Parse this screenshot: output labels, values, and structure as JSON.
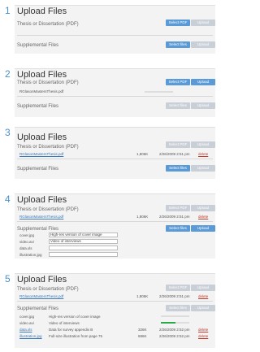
{
  "steps": [
    {
      "number": "1",
      "title": "Upload Files",
      "thesis_label": "Thesis or Dissertation (PDF)",
      "supp_label": "Supplemental Files",
      "select_pdf": "Select PDF",
      "upload": "Upload",
      "select_files": "Select files"
    },
    {
      "number": "2",
      "title": "Upload Files",
      "thesis_label": "Thesis or Dissertation (PDF)",
      "supp_label": "Supplemental Files",
      "select_pdf": "Select PDF",
      "upload": "Upload",
      "select_files": "Select files",
      "thesis_file": "RGlasonMastersThesis.pdf"
    },
    {
      "number": "3",
      "title": "Upload Files",
      "thesis_label": "Thesis or Dissertation (PDF)",
      "supp_label": "Supplemental Files",
      "select_pdf": "Select PDF",
      "upload": "Upload",
      "select_files": "Select files",
      "thesis_file": "RGlasonMastersThesis.pdf",
      "thesis_size": "1,806K",
      "thesis_date": "2/26/2009 2:51 pm",
      "thesis_delete": "delete"
    },
    {
      "number": "4",
      "title": "Upload Files",
      "thesis_label": "Thesis or Dissertation (PDF)",
      "supp_label": "Supplemental Files",
      "select_pdf": "Select PDF",
      "upload": "Upload",
      "select_files": "Select files",
      "thesis_file": "RGlasonMastersThesis.pdf",
      "thesis_size": "1,806K",
      "thesis_date": "2/26/2009 2:51 pm",
      "thesis_delete": "delete",
      "supp_files": [
        {
          "name": "cover.jpg",
          "desc": "High-res version of cover image"
        },
        {
          "name": "video.avi",
          "desc": "Video of interviews"
        },
        {
          "name": "data.xls",
          "desc": ""
        },
        {
          "name": "illustration.jpg",
          "desc": ""
        }
      ]
    },
    {
      "number": "5",
      "title": "Upload Files",
      "thesis_label": "Thesis or Dissertation (PDF)",
      "supp_label": "Supplemental Files",
      "select_pdf": "Select PDF",
      "upload": "Upload",
      "select_files": "Select files",
      "thesis_file": "RGlasonMastersThesis.pdf",
      "thesis_size": "1,806K",
      "thesis_date": "2/26/2009 2:51 pm",
      "thesis_delete": "delete",
      "supp_files": [
        {
          "name": "cover.jpg",
          "desc": "High-res version of cover image",
          "size": "",
          "date": "",
          "delete": ""
        },
        {
          "name": "video.avi",
          "desc": "Video of interviews",
          "size": "",
          "date": "",
          "delete": "",
          "progress": 0.5
        },
        {
          "name": "data.xls",
          "desc": "Data for survey appendix B",
          "size": "326K",
          "date": "2/26/2009 2:52 pm",
          "delete": "delete"
        },
        {
          "name": "illustration.jpg",
          "desc": "Full-size illustration from page 75",
          "size": "686K",
          "date": "2/26/2009 2:52 pm",
          "delete": "delete"
        }
      ]
    }
  ],
  "colors": {
    "accent": "#4a90c8",
    "button_blue": "#5a9ad6",
    "button_disabled": "#c9cfd6",
    "link": "#3a78b8",
    "delete": "#c0392b",
    "progress": "#2aa84a"
  }
}
